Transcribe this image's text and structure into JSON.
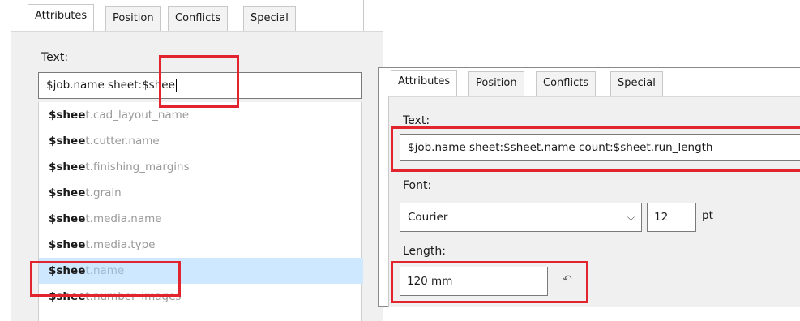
{
  "left_dialog": {
    "tabs": [
      "Attributes",
      "Position",
      "Conflicts",
      "Special"
    ],
    "text_label": "Text:",
    "text_value": "$job.name sheet:$shee",
    "suggestions": [
      {
        "match": "$shee",
        "rest": "t.cad_layout_name"
      },
      {
        "match": "$shee",
        "rest": "t.cutter.name"
      },
      {
        "match": "$shee",
        "rest": "t.finishing_margins"
      },
      {
        "match": "$shee",
        "rest": "t.grain"
      },
      {
        "match": "$shee",
        "rest": "t.media.name"
      },
      {
        "match": "$shee",
        "rest": "t.media.type"
      },
      {
        "match": "$shee",
        "rest": "t.name"
      },
      {
        "match": "$shee",
        "rest": "t.number_images"
      }
    ],
    "selected_suggestion_index": 6
  },
  "right_dialog": {
    "tabs": [
      "Attributes",
      "Position",
      "Conflicts",
      "Special"
    ],
    "text_label": "Text:",
    "text_value": "$job.name sheet:$sheet.name count:$sheet.run_length",
    "font_label": "Font:",
    "font_value": "Courier",
    "font_size": "12",
    "font_unit": "pt",
    "length_label": "Length:",
    "length_value": "120 mm"
  },
  "icons": {
    "dropdown": "chevron-down-icon",
    "reset": "reset-arrow-icon"
  },
  "colors": {
    "highlight_box": "#e2242f",
    "selection": "#cde8ff"
  }
}
